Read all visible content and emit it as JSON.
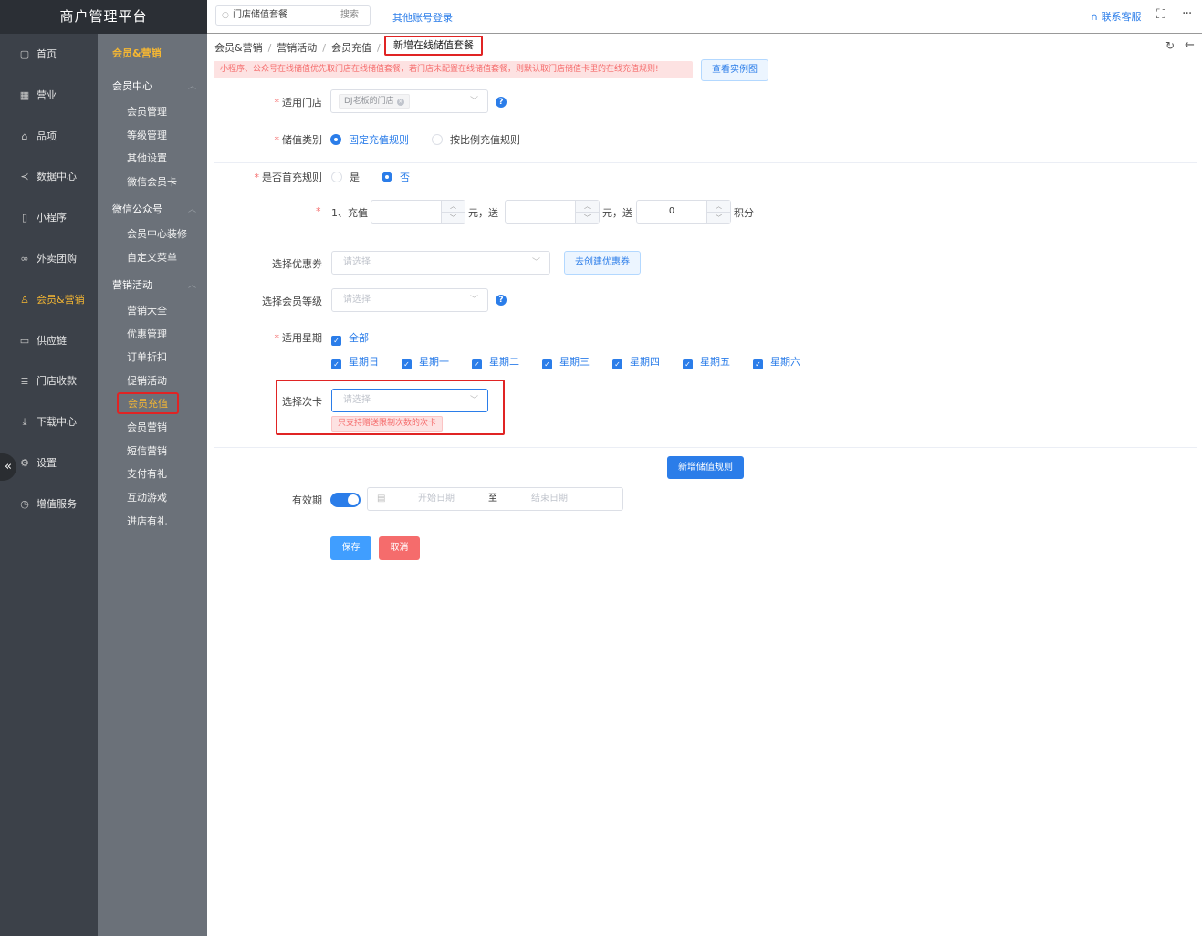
{
  "app": {
    "title": "商户管理平台"
  },
  "primary_nav": [
    {
      "label": "首页",
      "icon": "home-icon",
      "glyph": "▢"
    },
    {
      "label": "营业",
      "icon": "calendar-icon",
      "glyph": "▦"
    },
    {
      "label": "品项",
      "icon": "bag-icon",
      "glyph": "⌂"
    },
    {
      "label": "数据中心",
      "icon": "share-icon",
      "glyph": "≺"
    },
    {
      "label": "小程序",
      "icon": "phone-icon",
      "glyph": "▯"
    },
    {
      "label": "外卖团购",
      "icon": "bike-icon",
      "glyph": "∞"
    },
    {
      "label": "会员&营销",
      "icon": "user-icon",
      "glyph": "♙"
    },
    {
      "label": "供应链",
      "icon": "truck-icon",
      "glyph": "▭"
    },
    {
      "label": "门店收款",
      "icon": "database-icon",
      "glyph": "≣"
    },
    {
      "label": "下载中心",
      "icon": "download-icon",
      "glyph": "⤓"
    },
    {
      "label": "设置",
      "icon": "gear-icon",
      "glyph": "⚙"
    },
    {
      "label": "增值服务",
      "icon": "alarm-icon",
      "glyph": "◷"
    }
  ],
  "secondary_nav": {
    "heading": "会员&营销",
    "groups": [
      {
        "title": "会员中心",
        "items": [
          "会员管理",
          "等级管理",
          "其他设置",
          "微信会员卡"
        ]
      },
      {
        "title": "微信公众号",
        "items": [
          "会员中心装修",
          "自定义菜单"
        ]
      },
      {
        "title": "营销活动",
        "items": [
          "营销大全",
          "优惠管理",
          "订单折扣",
          "促销活动",
          "会员充值",
          "会员营销",
          "短信营销",
          "支付有礼",
          "互动游戏",
          "进店有礼"
        ]
      }
    ]
  },
  "topbar": {
    "search_value": "门店储值套餐",
    "search_button": "搜索",
    "other_login": "其他账号登录",
    "contact": "联系客服"
  },
  "breadcrumb": {
    "items": [
      "会员&营销",
      "营销活动",
      "会员充值"
    ],
    "current": "新增在线储值套餐"
  },
  "notice": "小程序、公众号在线储值优先取门店在线储值套餐，若门店未配置在线储值套餐，则默认取门店储值卡里的在线充值规则!",
  "sample_button": "查看实例图",
  "form": {
    "store": {
      "label": "适用门店",
      "tag": "DJ老板的门店"
    },
    "type": {
      "label": "储值类别",
      "options": [
        "固定充值规则",
        "按比例充值规则"
      ],
      "selected": "固定充值规则"
    },
    "first_recharge": {
      "label": "是否首充规则",
      "options": [
        "是",
        "否"
      ],
      "selected": "否"
    },
    "rule": {
      "prefix": "1、充值",
      "unit1": "元，送",
      "unit2": "元，送",
      "points_value": "0",
      "unit3": "积分"
    },
    "coupon": {
      "label": "选择优惠券",
      "placeholder": "请选择",
      "create_button": "去创建优惠券"
    },
    "member_level": {
      "label": "选择会员等级",
      "placeholder": "请选择"
    },
    "weekday": {
      "label": "适用星期",
      "all": "全部",
      "days": [
        "星期日",
        "星期一",
        "星期二",
        "星期三",
        "星期四",
        "星期五",
        "星期六"
      ]
    },
    "times_card": {
      "label": "选择次卡",
      "placeholder": "请选择",
      "hint": "只支持赠送限制次数的次卡"
    },
    "add_rule_button": "新增储值规则",
    "validity": {
      "label": "有效期",
      "start_placeholder": "开始日期",
      "separator": "至",
      "end_placeholder": "结束日期",
      "enabled": true
    },
    "save_button": "保存",
    "cancel_button": "取消"
  },
  "colors": {
    "accent": "#2b7de9",
    "highlight": "#e02424",
    "active_nav": "#f5b733",
    "danger": "#f56c6c"
  }
}
